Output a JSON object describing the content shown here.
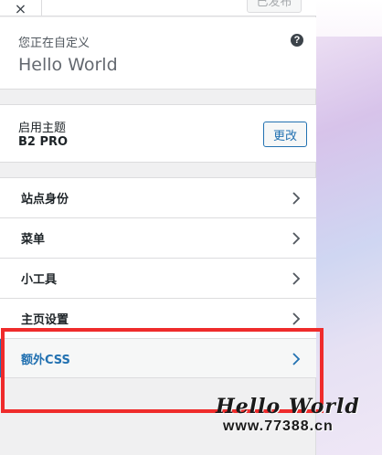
{
  "header": {
    "close_glyph": "×",
    "publish_label": "已发布"
  },
  "info": {
    "customizing_label": "您正在自定义",
    "site_title": "Hello World",
    "help_glyph": "?"
  },
  "theme": {
    "active_label": "启用主题",
    "name": "B2 PRO",
    "change_label": "更改"
  },
  "menu": {
    "items": [
      {
        "label": "站点身份",
        "active": false
      },
      {
        "label": "菜单",
        "active": false
      },
      {
        "label": "小工具",
        "active": false
      },
      {
        "label": "主页设置",
        "active": false
      },
      {
        "label": "额外CSS",
        "active": true
      }
    ]
  },
  "watermark": {
    "title": "Hello World",
    "url": "www.77388.cn"
  },
  "colors": {
    "accent": "#2271b1",
    "highlight_border": "#ef2b2b",
    "panel_bg": "#f0f0f1"
  },
  "icons": {
    "close": "close-icon",
    "help": "help-icon",
    "chevron": "chevron-right-icon"
  }
}
